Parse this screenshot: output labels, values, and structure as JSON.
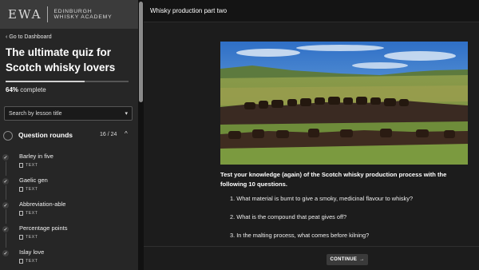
{
  "sidebar": {
    "logo": {
      "mark": "EWA",
      "line1": "EDINBURGH",
      "line2": "WHISKY ACADEMY"
    },
    "back_link": "Go to Dashboard",
    "course_title": "The ultimate quiz for Scotch whisky lovers",
    "progress": {
      "value": 64,
      "percent_label": "64%",
      "suffix": " complete"
    },
    "search_placeholder": "Search by lesson title",
    "section": {
      "title": "Question rounds",
      "count": "16 / 24"
    },
    "lessons": [
      {
        "title": "Barley in five",
        "type": "TEXT"
      },
      {
        "title": "Gaelic gen",
        "type": "TEXT"
      },
      {
        "title": "Abbreviation-able",
        "type": "TEXT"
      },
      {
        "title": "Percentage points",
        "type": "TEXT"
      },
      {
        "title": "Islay love",
        "type": "TEXT"
      }
    ]
  },
  "main": {
    "lesson_title": "Whisky production part two",
    "intro": "Test your knowledge (again) of the Scotch whisky production process with the following 10 questions.",
    "questions": [
      "1. What material is burnt to give a smoky, medicinal flavour to whisky?",
      "2. What is the compound that peat gives off?",
      "3. In the malting process, what comes before kilning?"
    ],
    "continue_label": "CONTINUE"
  },
  "colors": {
    "sidebar_bg": "#262626",
    "main_bg": "#1c1c1c",
    "accent": "#d0d0d0"
  }
}
